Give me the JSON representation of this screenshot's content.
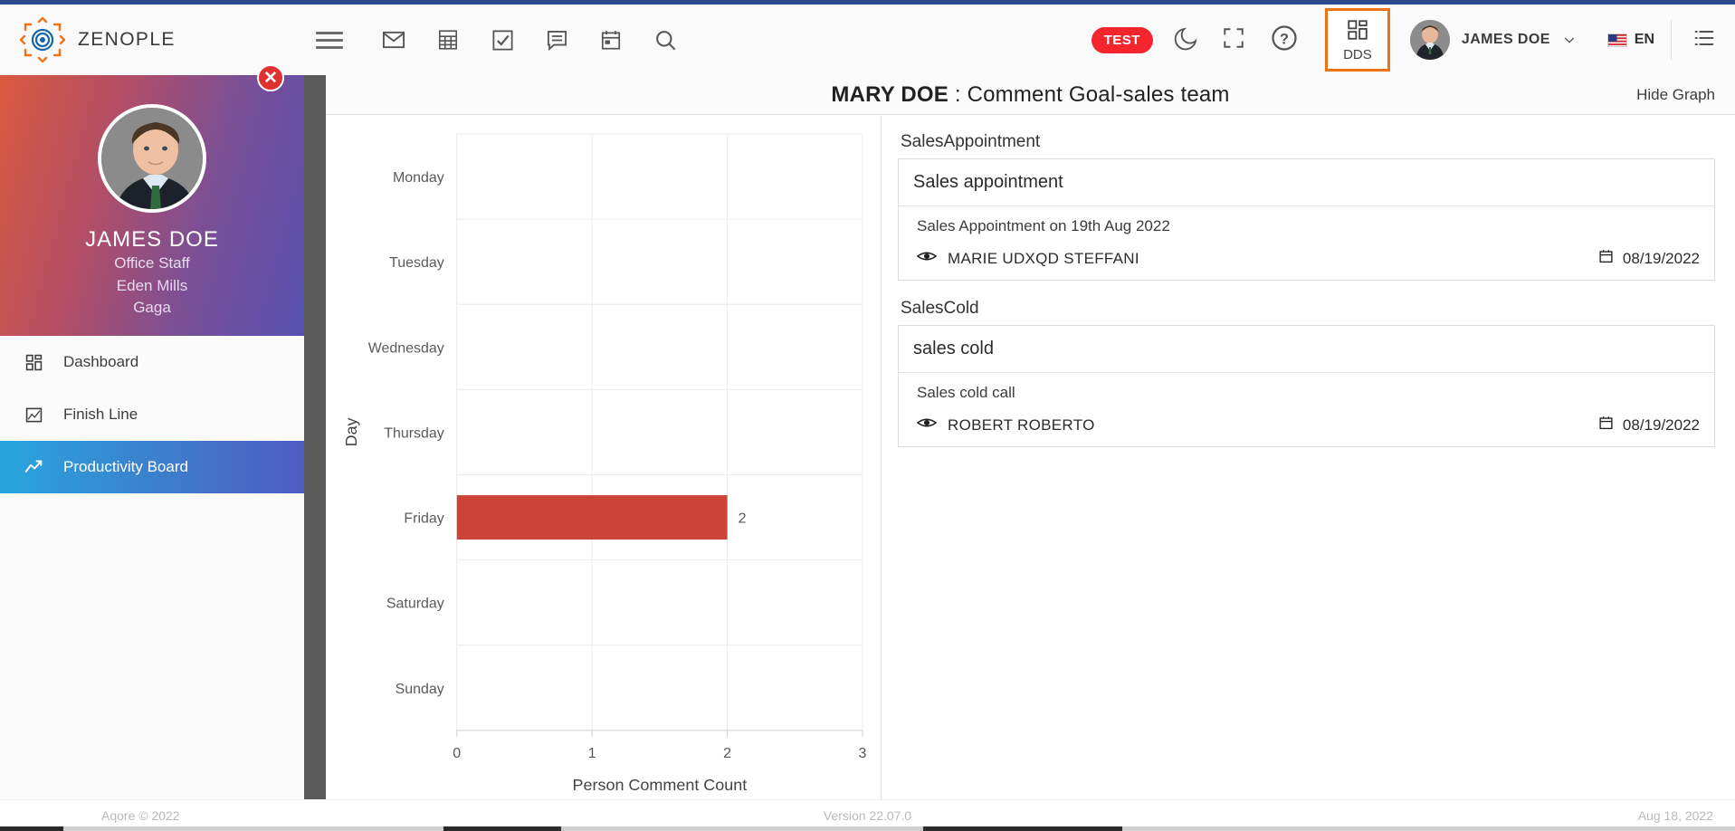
{
  "header": {
    "brand_name": "ZENOPLE",
    "logo_icon": "target-logo-icon",
    "menu_toggle_icon": "hamburger-icon",
    "tools": [
      {
        "icon": "envelope-icon",
        "name": "mail"
      },
      {
        "icon": "calculator-icon",
        "name": "calculator"
      },
      {
        "icon": "checkbox-icon",
        "name": "tasks"
      },
      {
        "icon": "comment-icon",
        "name": "messages"
      },
      {
        "icon": "calendar-icon",
        "name": "calendar"
      },
      {
        "icon": "search-icon",
        "name": "search"
      }
    ],
    "test_badge": "TEST",
    "dark_mode_icon": "moon-icon",
    "fullscreen_icon": "expand-icon",
    "help_icon": "question-circle-icon",
    "dds_label": "DDS",
    "dds_icon": "grid-icon",
    "user_name": "JAMES DOE",
    "user_caret_icon": "chevron-down-icon",
    "language": "EN",
    "flag_icon": "us-flag-icon",
    "right_list_icon": "list-icon",
    "accent_color": "#ef7216",
    "badge_color": "#f5252d"
  },
  "sidebar": {
    "profile": {
      "name": "JAMES DOE",
      "role": "Office Staff",
      "branch": "Eden Mills",
      "department": "Gaga"
    },
    "items": [
      {
        "label": "Dashboard",
        "icon": "grid-icon",
        "active": false
      },
      {
        "label": "Finish Line",
        "icon": "chart-image-icon",
        "active": false
      },
      {
        "label": "Productivity Board",
        "icon": "trend-up-icon",
        "active": true
      }
    ],
    "active_color": "#28a6dc"
  },
  "modal": {
    "close_icon": "close-circle-icon",
    "title_person": "MARY DOE",
    "title_separator": " : ",
    "title_rest": "Comment Goal-sales team",
    "hide_graph_label": "Hide Graph"
  },
  "detail": {
    "groups": [
      {
        "title": "SalesAppointment",
        "card_head": "Sales appointment",
        "rows": [
          {
            "title": "Sales Appointment on 19th Aug 2022",
            "person": "MARIE UDXQD STEFFANI",
            "person_icon": "eye-icon",
            "date": "08/19/2022",
            "date_icon": "calendar-icon"
          }
        ]
      },
      {
        "title": "SalesCold",
        "card_head": "sales cold",
        "rows": [
          {
            "title": "Sales cold call",
            "person": "ROBERT ROBERTO",
            "person_icon": "eye-icon",
            "date": "08/19/2022",
            "date_icon": "calendar-icon"
          }
        ]
      }
    ]
  },
  "chart_data": {
    "type": "bar",
    "orientation": "horizontal",
    "title": "",
    "categories": [
      "Monday",
      "Tuesday",
      "Wednesday",
      "Thursday",
      "Friday",
      "Saturday",
      "Sunday"
    ],
    "values": [
      0,
      0,
      0,
      0,
      2,
      0,
      0
    ],
    "data_labels": [
      "",
      "",
      "",
      "",
      "2",
      "",
      ""
    ],
    "xlabel": "Person Comment Count",
    "ylabel": "Day",
    "xticks": [
      "0",
      "1",
      "2",
      "3"
    ],
    "xlim": [
      0,
      3
    ],
    "grid": true,
    "legend": "none",
    "bar_color": "#cc4337"
  },
  "footer": {
    "left": "Aqore © 2022",
    "middle": "Version 22.07.0",
    "right": "Aug 18, 2022"
  }
}
